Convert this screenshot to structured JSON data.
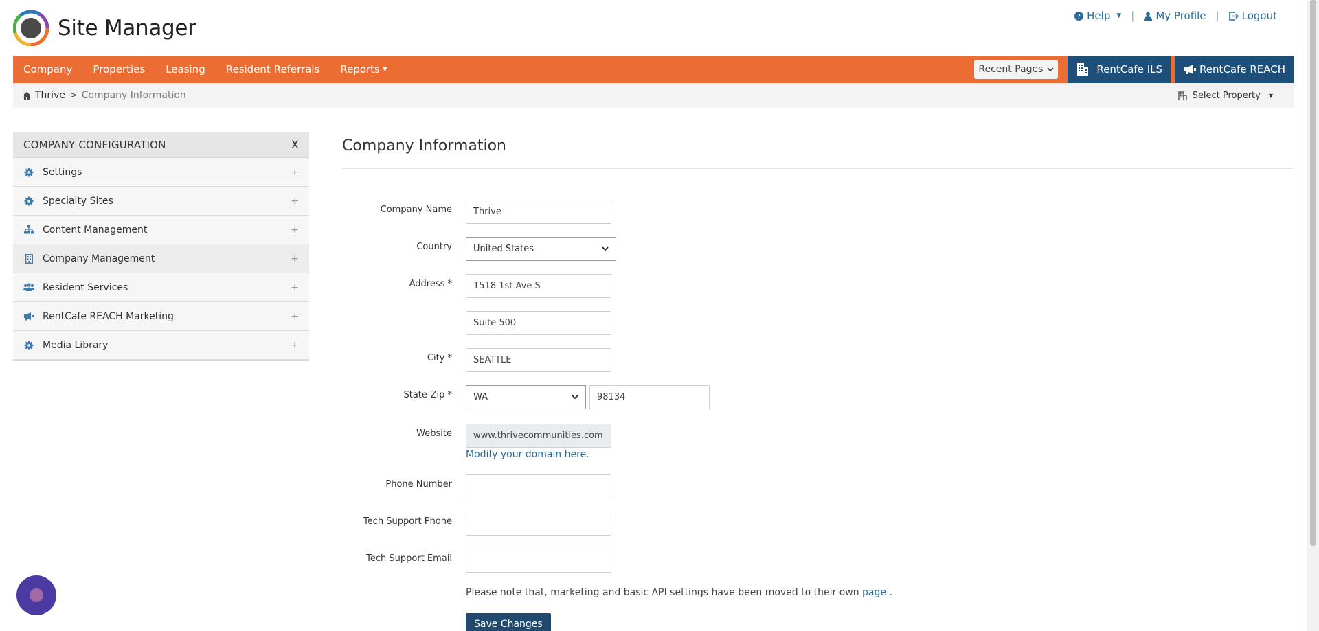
{
  "header": {
    "app_title": "Site Manager",
    "help_label": "Help",
    "profile_label": "My Profile",
    "logout_label": "Logout",
    "separator": "|"
  },
  "nav": {
    "items": [
      {
        "label": "Company"
      },
      {
        "label": "Properties"
      },
      {
        "label": "Leasing"
      },
      {
        "label": "Resident Referrals"
      },
      {
        "label": "Reports"
      }
    ],
    "recent_pages_label": "Recent Pages",
    "ils_label": "RentCafe ILS",
    "reach_label": "RentCafe REACH",
    "accent_color": "#ec6d33",
    "brand_blue": "#1e4f7a"
  },
  "breadcrumb": {
    "home": "Thrive",
    "separator": ">",
    "current": "Company Information",
    "select_property_label": "Select Property"
  },
  "sidebar": {
    "title": "COMPANY CONFIGURATION",
    "close_label": "X",
    "items": [
      {
        "label": "Settings",
        "icon": "gear-icon"
      },
      {
        "label": "Specialty Sites",
        "icon": "gear-icon"
      },
      {
        "label": "Content Management",
        "icon": "sitemap-icon"
      },
      {
        "label": "Company Management",
        "icon": "building-icon"
      },
      {
        "label": "Resident Services",
        "icon": "users-icon"
      },
      {
        "label": "RentCafe REACH Marketing",
        "icon": "megaphone-icon"
      },
      {
        "label": "Media Library",
        "icon": "gear-icon"
      }
    ],
    "plus": "+"
  },
  "form": {
    "page_title": "Company Information",
    "company_name_label": "Company Name",
    "company_name_value": "Thrive",
    "country_label": "Country",
    "country_value": "United States",
    "address_label": "Address *",
    "address1_value": "1518 1st Ave S",
    "address2_value": "Suite 500",
    "city_label": "City *",
    "city_value": "SEATTLE",
    "state_zip_label": "State-Zip *",
    "state_value": "WA",
    "zip_value": "98134",
    "website_label": "Website",
    "website_value": "www.thrivecommunities.com",
    "modify_domain_link": "Modify your domain here.",
    "phone_label": "Phone Number",
    "phone_value": "",
    "tech_phone_label": "Tech Support Phone",
    "tech_phone_value": "",
    "tech_email_label": "Tech Support Email",
    "tech_email_value": "",
    "note_text": "Please note that, marketing and basic API settings have been moved to their own",
    "note_link": "page",
    "note_end": ".",
    "save_label": "Save Changes"
  }
}
